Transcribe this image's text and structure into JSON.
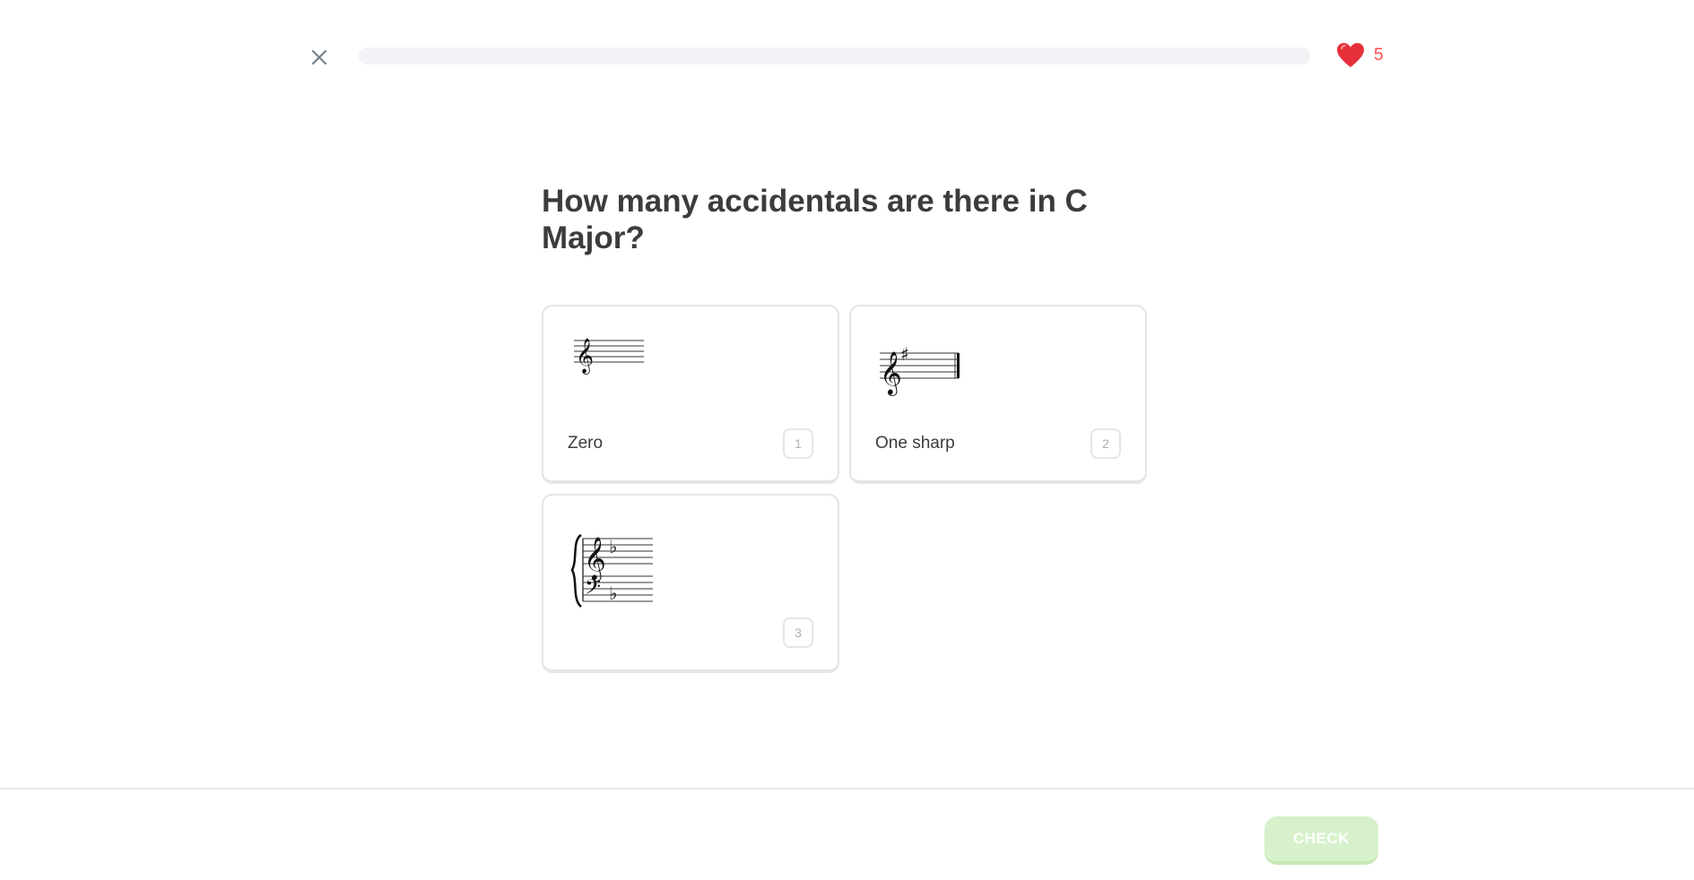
{
  "header": {
    "close_icon": "close-icon",
    "progress": 0,
    "hearts_icon": "heart-icon",
    "hearts_count": "5"
  },
  "question": {
    "text": "How many accidentals are there in C Major?"
  },
  "choices": [
    {
      "image": "treble-staff-no-accidentals",
      "label": "Zero",
      "key": "1"
    },
    {
      "image": "treble-staff-one-sharp",
      "label": "One sharp",
      "key": "2"
    },
    {
      "image": "grand-staff-one-flat",
      "label": "",
      "key": "3"
    }
  ],
  "footer": {
    "check_label": "CHECK"
  },
  "colors": {
    "heart": "#ff4b4b",
    "check_disabled_bg": "#d7f1cc",
    "progress_track": "#f1f3f6"
  }
}
